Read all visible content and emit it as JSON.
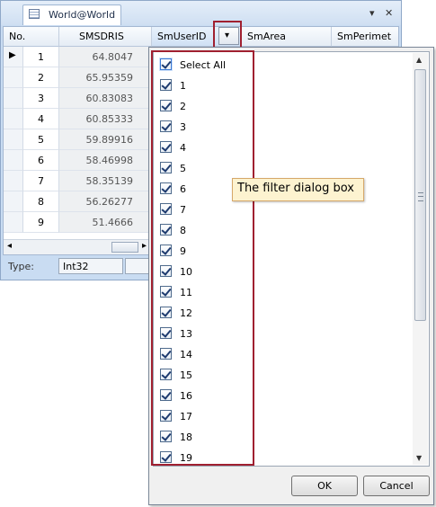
{
  "window": {
    "tab_title": "World@World",
    "menu_glyph": "▾",
    "close_glyph": "✕"
  },
  "grid": {
    "columns": [
      "No.",
      "SMSDRIS",
      "SmUserID",
      "SmArea",
      "SmPerimet"
    ],
    "current_row_marker": "▶",
    "rows": [
      {
        "no": "1",
        "smsdris": "64.8047"
      },
      {
        "no": "2",
        "smsdris": "65.95359"
      },
      {
        "no": "3",
        "smsdris": "60.83083"
      },
      {
        "no": "4",
        "smsdris": "60.85333"
      },
      {
        "no": "5",
        "smsdris": "59.89916"
      },
      {
        "no": "6",
        "smsdris": "58.46998"
      },
      {
        "no": "7",
        "smsdris": "58.35139"
      },
      {
        "no": "8",
        "smsdris": "56.26277"
      },
      {
        "no": "9",
        "smsdris": "51.4666"
      }
    ],
    "scroll_left_glyph": "◂",
    "scroll_right_glyph": "▸"
  },
  "typebar": {
    "label": "Type:",
    "value": "Int32"
  },
  "filter_button": {
    "glyph": "▾"
  },
  "filter_popup": {
    "items": [
      "Select All",
      "1",
      "2",
      "3",
      "4",
      "5",
      "6",
      "7",
      "8",
      "9",
      "10",
      "11",
      "12",
      "13",
      "14",
      "15",
      "16",
      "17",
      "18",
      "19"
    ],
    "scroll_up_glyph": "▲",
    "scroll_down_glyph": "▼",
    "ok_label": "OK",
    "cancel_label": "Cancel"
  },
  "callout": {
    "text": "The filter dialog box"
  },
  "colors": {
    "highlight_border": "#a02030",
    "callout_bg": "#fdf3d0",
    "frame_blue": "#c9dcf2"
  }
}
